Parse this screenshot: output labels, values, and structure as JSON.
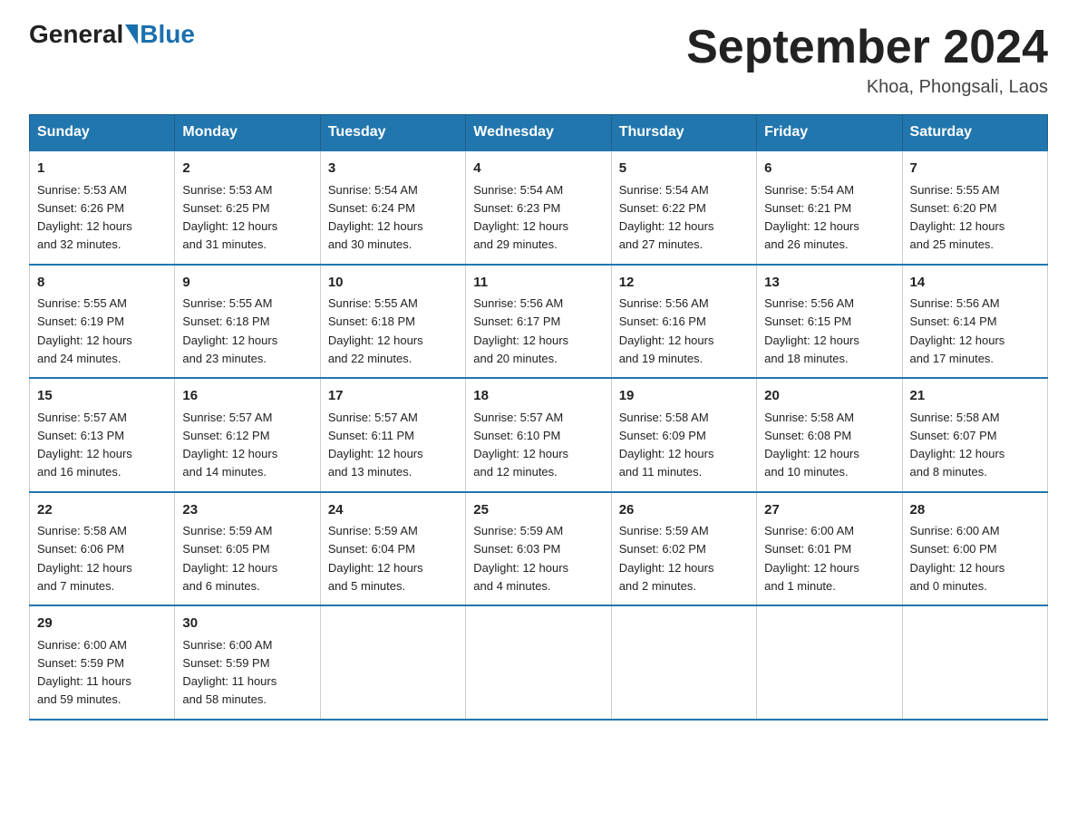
{
  "logo": {
    "general": "General",
    "blue": "Blue"
  },
  "title": "September 2024",
  "subtitle": "Khoa, Phongsali, Laos",
  "days_of_week": [
    "Sunday",
    "Monday",
    "Tuesday",
    "Wednesday",
    "Thursday",
    "Friday",
    "Saturday"
  ],
  "weeks": [
    [
      {
        "num": "1",
        "info": "Sunrise: 5:53 AM\nSunset: 6:26 PM\nDaylight: 12 hours\nand 32 minutes."
      },
      {
        "num": "2",
        "info": "Sunrise: 5:53 AM\nSunset: 6:25 PM\nDaylight: 12 hours\nand 31 minutes."
      },
      {
        "num": "3",
        "info": "Sunrise: 5:54 AM\nSunset: 6:24 PM\nDaylight: 12 hours\nand 30 minutes."
      },
      {
        "num": "4",
        "info": "Sunrise: 5:54 AM\nSunset: 6:23 PM\nDaylight: 12 hours\nand 29 minutes."
      },
      {
        "num": "5",
        "info": "Sunrise: 5:54 AM\nSunset: 6:22 PM\nDaylight: 12 hours\nand 27 minutes."
      },
      {
        "num": "6",
        "info": "Sunrise: 5:54 AM\nSunset: 6:21 PM\nDaylight: 12 hours\nand 26 minutes."
      },
      {
        "num": "7",
        "info": "Sunrise: 5:55 AM\nSunset: 6:20 PM\nDaylight: 12 hours\nand 25 minutes."
      }
    ],
    [
      {
        "num": "8",
        "info": "Sunrise: 5:55 AM\nSunset: 6:19 PM\nDaylight: 12 hours\nand 24 minutes."
      },
      {
        "num": "9",
        "info": "Sunrise: 5:55 AM\nSunset: 6:18 PM\nDaylight: 12 hours\nand 23 minutes."
      },
      {
        "num": "10",
        "info": "Sunrise: 5:55 AM\nSunset: 6:18 PM\nDaylight: 12 hours\nand 22 minutes."
      },
      {
        "num": "11",
        "info": "Sunrise: 5:56 AM\nSunset: 6:17 PM\nDaylight: 12 hours\nand 20 minutes."
      },
      {
        "num": "12",
        "info": "Sunrise: 5:56 AM\nSunset: 6:16 PM\nDaylight: 12 hours\nand 19 minutes."
      },
      {
        "num": "13",
        "info": "Sunrise: 5:56 AM\nSunset: 6:15 PM\nDaylight: 12 hours\nand 18 minutes."
      },
      {
        "num": "14",
        "info": "Sunrise: 5:56 AM\nSunset: 6:14 PM\nDaylight: 12 hours\nand 17 minutes."
      }
    ],
    [
      {
        "num": "15",
        "info": "Sunrise: 5:57 AM\nSunset: 6:13 PM\nDaylight: 12 hours\nand 16 minutes."
      },
      {
        "num": "16",
        "info": "Sunrise: 5:57 AM\nSunset: 6:12 PM\nDaylight: 12 hours\nand 14 minutes."
      },
      {
        "num": "17",
        "info": "Sunrise: 5:57 AM\nSunset: 6:11 PM\nDaylight: 12 hours\nand 13 minutes."
      },
      {
        "num": "18",
        "info": "Sunrise: 5:57 AM\nSunset: 6:10 PM\nDaylight: 12 hours\nand 12 minutes."
      },
      {
        "num": "19",
        "info": "Sunrise: 5:58 AM\nSunset: 6:09 PM\nDaylight: 12 hours\nand 11 minutes."
      },
      {
        "num": "20",
        "info": "Sunrise: 5:58 AM\nSunset: 6:08 PM\nDaylight: 12 hours\nand 10 minutes."
      },
      {
        "num": "21",
        "info": "Sunrise: 5:58 AM\nSunset: 6:07 PM\nDaylight: 12 hours\nand 8 minutes."
      }
    ],
    [
      {
        "num": "22",
        "info": "Sunrise: 5:58 AM\nSunset: 6:06 PM\nDaylight: 12 hours\nand 7 minutes."
      },
      {
        "num": "23",
        "info": "Sunrise: 5:59 AM\nSunset: 6:05 PM\nDaylight: 12 hours\nand 6 minutes."
      },
      {
        "num": "24",
        "info": "Sunrise: 5:59 AM\nSunset: 6:04 PM\nDaylight: 12 hours\nand 5 minutes."
      },
      {
        "num": "25",
        "info": "Sunrise: 5:59 AM\nSunset: 6:03 PM\nDaylight: 12 hours\nand 4 minutes."
      },
      {
        "num": "26",
        "info": "Sunrise: 5:59 AM\nSunset: 6:02 PM\nDaylight: 12 hours\nand 2 minutes."
      },
      {
        "num": "27",
        "info": "Sunrise: 6:00 AM\nSunset: 6:01 PM\nDaylight: 12 hours\nand 1 minute."
      },
      {
        "num": "28",
        "info": "Sunrise: 6:00 AM\nSunset: 6:00 PM\nDaylight: 12 hours\nand 0 minutes."
      }
    ],
    [
      {
        "num": "29",
        "info": "Sunrise: 6:00 AM\nSunset: 5:59 PM\nDaylight: 11 hours\nand 59 minutes."
      },
      {
        "num": "30",
        "info": "Sunrise: 6:00 AM\nSunset: 5:59 PM\nDaylight: 11 hours\nand 58 minutes."
      },
      {
        "num": "",
        "info": ""
      },
      {
        "num": "",
        "info": ""
      },
      {
        "num": "",
        "info": ""
      },
      {
        "num": "",
        "info": ""
      },
      {
        "num": "",
        "info": ""
      }
    ]
  ]
}
